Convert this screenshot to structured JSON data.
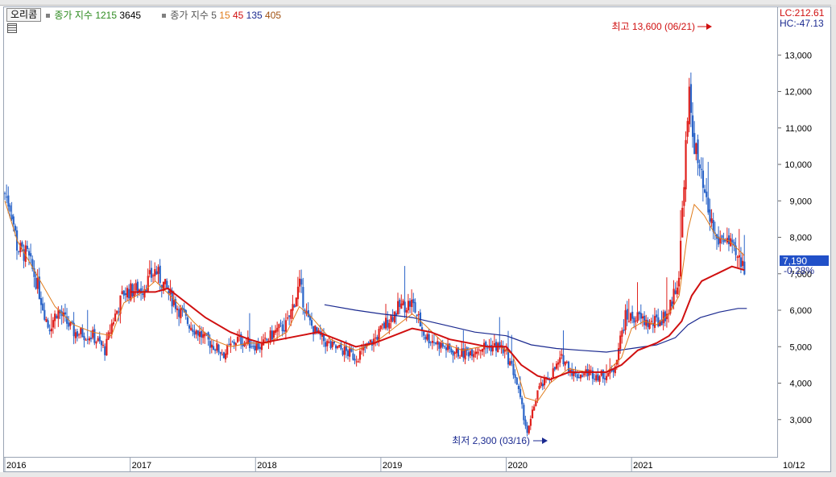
{
  "legend": {
    "symbol": "오리콤",
    "ind1_name": "종가 지수",
    "ind1_p1": "1215",
    "ind1_p2": "3645",
    "ind2_name": "종가 지수 5",
    "ind2_p1": "15",
    "ind2_p2": "45",
    "ind2_p3": "135",
    "ind2_p4": "405"
  },
  "scale": {
    "lc": "LC:212.61",
    "hc": "HC:-47.13"
  },
  "annotations": {
    "high_label": "최고 13,600 (06/21)",
    "low_label": "최저 2,300 (03/16)"
  },
  "current": {
    "price_label": "7,190",
    "change_label": "-0.28%"
  },
  "x_end_label": "10/12",
  "colors": {
    "up": "#e0201c",
    "down": "#2b64c8",
    "ma15": "#e07b1a",
    "ma45": "#d01010",
    "ma135": "#1b2a90",
    "price_box": "#2150c8",
    "axis_bg": "#ffffff"
  },
  "chart_data": {
    "type": "candlestick",
    "x_labels": [
      "2016",
      "2017",
      "2018",
      "2019",
      "2020",
      "2021"
    ],
    "y_ticks": [
      "3,000",
      "4,000",
      "5,000",
      "6,000",
      "7,000",
      "8,000",
      "9,000",
      "10,000",
      "11,000",
      "12,000",
      "13,000"
    ],
    "ylim": [
      2000,
      14200
    ],
    "xlim": [
      2016.0,
      2021.95
    ],
    "price_path": [
      [
        2016.0,
        9200
      ],
      [
        2016.05,
        8800
      ],
      [
        2016.1,
        7700
      ],
      [
        2016.18,
        7500
      ],
      [
        2016.25,
        6800
      ],
      [
        2016.35,
        5500
      ],
      [
        2016.42,
        6000
      ],
      [
        2016.55,
        5400
      ],
      [
        2016.7,
        5300
      ],
      [
        2016.8,
        4900
      ],
      [
        2016.85,
        5600
      ],
      [
        2016.95,
        6500
      ],
      [
        2017.1,
        6600
      ],
      [
        2017.2,
        7100
      ],
      [
        2017.3,
        6500
      ],
      [
        2017.45,
        5700
      ],
      [
        2017.6,
        5200
      ],
      [
        2017.75,
        4800
      ],
      [
        2017.85,
        5200
      ],
      [
        2017.95,
        5100
      ],
      [
        2018.05,
        5000
      ],
      [
        2018.15,
        5400
      ],
      [
        2018.25,
        5600
      ],
      [
        2018.35,
        6700
      ],
      [
        2018.42,
        5700
      ],
      [
        2018.5,
        5300
      ],
      [
        2018.6,
        5000
      ],
      [
        2018.7,
        4900
      ],
      [
        2018.8,
        4700
      ],
      [
        2018.95,
        5200
      ],
      [
        2019.05,
        5700
      ],
      [
        2019.15,
        6100
      ],
      [
        2019.25,
        6200
      ],
      [
        2019.35,
        5300
      ],
      [
        2019.45,
        5100
      ],
      [
        2019.55,
        4900
      ],
      [
        2019.65,
        4800
      ],
      [
        2019.8,
        5000
      ],
      [
        2019.95,
        5000
      ],
      [
        2020.0,
        4800
      ],
      [
        2020.07,
        4200
      ],
      [
        2020.12,
        3400
      ],
      [
        2020.17,
        2600
      ],
      [
        2020.25,
        3800
      ],
      [
        2020.35,
        4200
      ],
      [
        2020.45,
        4700
      ],
      [
        2020.55,
        4200
      ],
      [
        2020.65,
        4300
      ],
      [
        2020.75,
        4200
      ],
      [
        2020.85,
        4300
      ],
      [
        2020.95,
        5800
      ],
      [
        2021.05,
        5800
      ],
      [
        2021.15,
        5600
      ],
      [
        2021.22,
        5700
      ],
      [
        2021.3,
        6000
      ],
      [
        2021.38,
        7000
      ],
      [
        2021.42,
        9800
      ],
      [
        2021.46,
        11800
      ],
      [
        2021.5,
        10600
      ],
      [
        2021.54,
        9800
      ],
      [
        2021.6,
        8800
      ],
      [
        2021.68,
        7900
      ],
      [
        2021.75,
        8000
      ],
      [
        2021.82,
        7500
      ],
      [
        2021.9,
        7190
      ]
    ],
    "ma15": [
      [
        2016.0,
        9000
      ],
      [
        2016.1,
        7900
      ],
      [
        2016.25,
        7000
      ],
      [
        2016.4,
        6100
      ],
      [
        2016.55,
        5600
      ],
      [
        2016.7,
        5400
      ],
      [
        2016.85,
        5300
      ],
      [
        2016.95,
        6200
      ],
      [
        2017.1,
        6500
      ],
      [
        2017.2,
        6800
      ],
      [
        2017.35,
        6300
      ],
      [
        2017.5,
        5700
      ],
      [
        2017.65,
        5200
      ],
      [
        2017.8,
        5000
      ],
      [
        2017.95,
        5100
      ],
      [
        2018.1,
        5100
      ],
      [
        2018.25,
        5400
      ],
      [
        2018.35,
        6100
      ],
      [
        2018.45,
        5800
      ],
      [
        2018.6,
        5200
      ],
      [
        2018.8,
        4900
      ],
      [
        2018.95,
        5100
      ],
      [
        2019.1,
        5500
      ],
      [
        2019.25,
        5900
      ],
      [
        2019.35,
        5600
      ],
      [
        2019.5,
        5100
      ],
      [
        2019.65,
        4900
      ],
      [
        2019.8,
        5000
      ],
      [
        2019.95,
        5000
      ],
      [
        2020.05,
        4800
      ],
      [
        2020.15,
        3600
      ],
      [
        2020.25,
        3500
      ],
      [
        2020.35,
        4000
      ],
      [
        2020.5,
        4400
      ],
      [
        2020.65,
        4300
      ],
      [
        2020.8,
        4300
      ],
      [
        2020.92,
        4700
      ],
      [
        2021.0,
        5500
      ],
      [
        2021.1,
        5700
      ],
      [
        2021.2,
        5600
      ],
      [
        2021.3,
        5900
      ],
      [
        2021.38,
        6400
      ],
      [
        2021.45,
        8200
      ],
      [
        2021.5,
        8900
      ],
      [
        2021.58,
        8600
      ],
      [
        2021.68,
        8000
      ],
      [
        2021.78,
        7900
      ],
      [
        2021.9,
        7500
      ]
    ],
    "ma45": [
      [
        2017.0,
        6500
      ],
      [
        2017.2,
        6500
      ],
      [
        2017.3,
        6600
      ],
      [
        2017.45,
        6200
      ],
      [
        2017.6,
        5800
      ],
      [
        2017.8,
        5400
      ],
      [
        2017.95,
        5200
      ],
      [
        2018.05,
        5100
      ],
      [
        2018.2,
        5200
      ],
      [
        2018.35,
        5300
      ],
      [
        2018.5,
        5400
      ],
      [
        2018.65,
        5200
      ],
      [
        2018.8,
        5000
      ],
      [
        2018.95,
        5100
      ],
      [
        2019.1,
        5300
      ],
      [
        2019.25,
        5500
      ],
      [
        2019.4,
        5400
      ],
      [
        2019.55,
        5200
      ],
      [
        2019.7,
        5100
      ],
      [
        2019.85,
        5000
      ],
      [
        2020.0,
        5000
      ],
      [
        2020.12,
        4500
      ],
      [
        2020.25,
        4200
      ],
      [
        2020.35,
        4100
      ],
      [
        2020.5,
        4300
      ],
      [
        2020.65,
        4300
      ],
      [
        2020.8,
        4300
      ],
      [
        2020.92,
        4500
      ],
      [
        2021.05,
        4900
      ],
      [
        2021.2,
        5100
      ],
      [
        2021.3,
        5300
      ],
      [
        2021.4,
        5700
      ],
      [
        2021.48,
        6400
      ],
      [
        2021.56,
        6800
      ],
      [
        2021.68,
        7000
      ],
      [
        2021.8,
        7200
      ],
      [
        2021.9,
        7100
      ]
    ],
    "ma135": [
      [
        2018.55,
        6150
      ],
      [
        2018.8,
        6000
      ],
      [
        2019.0,
        5900
      ],
      [
        2019.25,
        5800
      ],
      [
        2019.5,
        5600
      ],
      [
        2019.75,
        5400
      ],
      [
        2020.0,
        5300
      ],
      [
        2020.2,
        5050
      ],
      [
        2020.4,
        4950
      ],
      [
        2020.6,
        4900
      ],
      [
        2020.8,
        4850
      ],
      [
        2021.0,
        4950
      ],
      [
        2021.2,
        5050
      ],
      [
        2021.35,
        5250
      ],
      [
        2021.45,
        5600
      ],
      [
        2021.55,
        5800
      ],
      [
        2021.7,
        5950
      ],
      [
        2021.85,
        6050
      ],
      [
        2021.92,
        6050
      ]
    ]
  }
}
